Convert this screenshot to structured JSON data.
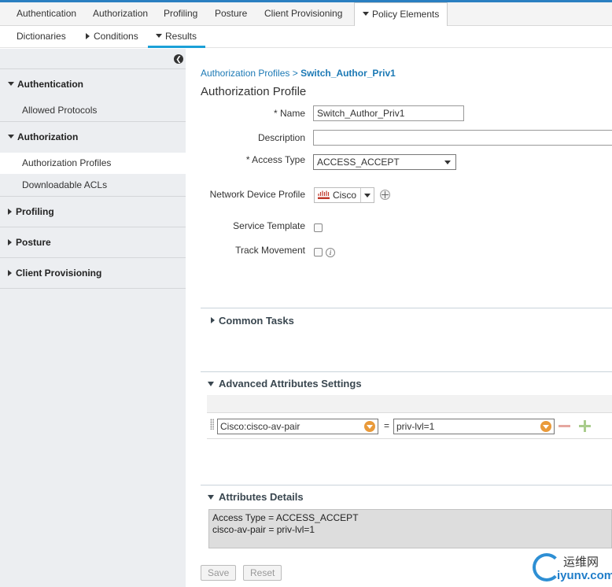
{
  "top_nav": {
    "tabs": [
      "Authentication",
      "Authorization",
      "Profiling",
      "Posture",
      "Client Provisioning",
      "Policy Elements"
    ],
    "active_tab": "Policy Elements"
  },
  "sub_nav": {
    "items": [
      "Dictionaries",
      "Conditions",
      "Results"
    ],
    "active": "Results"
  },
  "sidebar": {
    "sections": [
      {
        "label": "Authentication",
        "expanded": true,
        "items": [
          "Allowed Protocols"
        ]
      },
      {
        "label": "Authorization",
        "expanded": true,
        "items": [
          "Authorization Profiles",
          "Downloadable ACLs"
        ]
      },
      {
        "label": "Profiling",
        "expanded": false,
        "items": []
      },
      {
        "label": "Posture",
        "expanded": false,
        "items": []
      },
      {
        "label": "Client Provisioning",
        "expanded": false,
        "items": []
      }
    ],
    "selected_item": "Authorization Profiles"
  },
  "breadcrumb": {
    "parent": "Authorization Profiles",
    "separator": ">",
    "current": "Switch_Author_Priv1"
  },
  "page_title": "Authorization Profile",
  "form": {
    "name_label": "* Name",
    "name_value": "Switch_Author_Priv1",
    "description_label": "Description",
    "description_value": "",
    "access_type_label": "* Access Type",
    "access_type_value": "ACCESS_ACCEPT",
    "ndp_label": "Network Device Profile",
    "ndp_value": "Cisco",
    "service_template_label": "Service Template",
    "service_template_checked": false,
    "track_movement_label": "Track Movement",
    "track_movement_checked": false
  },
  "sections": {
    "common_tasks": "Common Tasks",
    "advanced_attributes": "Advanced Attributes Settings",
    "attributes_details": "Attributes Details"
  },
  "advanced_row": {
    "attribute": "Cisco:cisco-av-pair",
    "operator": "=",
    "value": "priv-lvl=1"
  },
  "attributes_details": {
    "lines": [
      "Access Type = ACCESS_ACCEPT",
      "cisco-av-pair = priv-lvl=1"
    ]
  },
  "buttons": {
    "save": "Save",
    "reset": "Reset"
  },
  "watermark": {
    "cn": "运维网",
    "url": "iyunv.com"
  },
  "colors": {
    "accent": "#1ba0d7",
    "link": "#1b79b5",
    "add": "#a9cc8c",
    "remove": "#e5a7a0",
    "combo_button": "#e99a3a"
  }
}
